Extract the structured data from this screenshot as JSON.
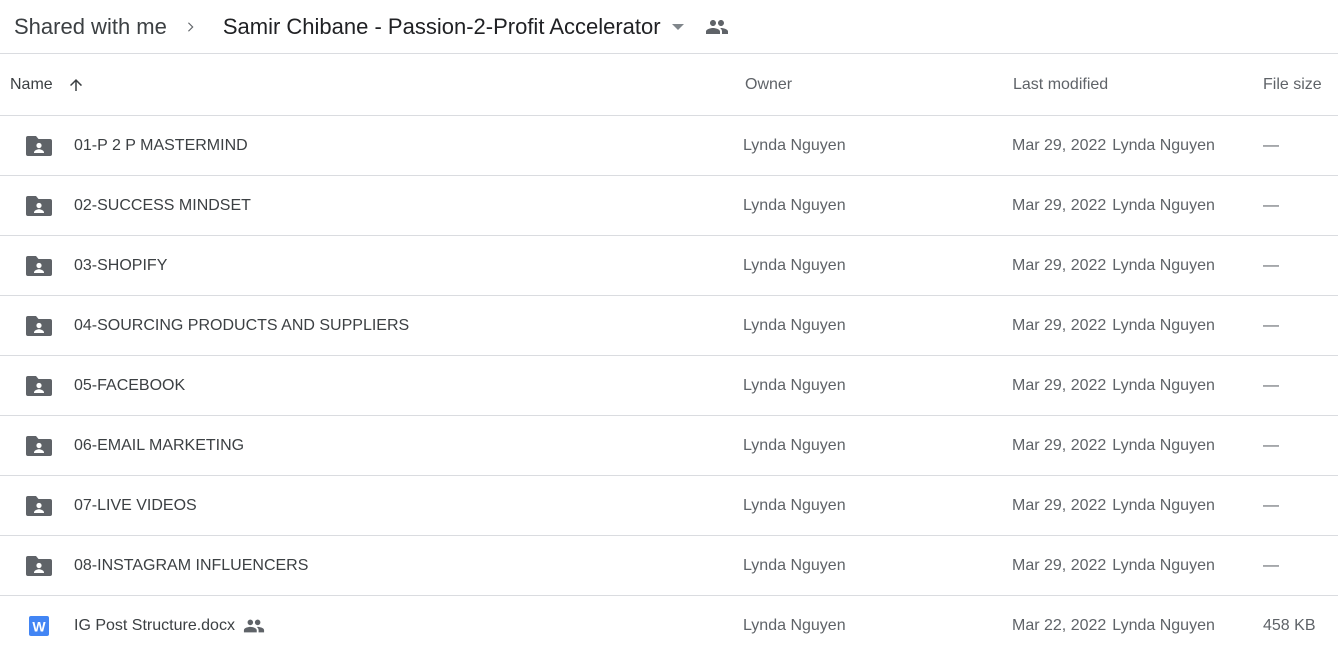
{
  "breadcrumb": {
    "root": "Shared with me",
    "current": "Samir Chibane - Passion-2-Profit Accelerator"
  },
  "columns": {
    "name": "Name",
    "owner": "Owner",
    "last_modified": "Last modified",
    "file_size": "File size"
  },
  "rows": [
    {
      "type": "folder",
      "name": "01-P 2 P MASTERMIND",
      "owner": "Lynda Nguyen",
      "modified_date": "Mar 29, 2022",
      "modified_by": "Lynda Nguyen",
      "size": "—"
    },
    {
      "type": "folder",
      "name": "02-SUCCESS MINDSET",
      "owner": "Lynda Nguyen",
      "modified_date": "Mar 29, 2022",
      "modified_by": "Lynda Nguyen",
      "size": "—"
    },
    {
      "type": "folder",
      "name": "03-SHOPIFY",
      "owner": "Lynda Nguyen",
      "modified_date": "Mar 29, 2022",
      "modified_by": "Lynda Nguyen",
      "size": "—"
    },
    {
      "type": "folder",
      "name": "04-SOURCING PRODUCTS AND SUPPLIERS",
      "owner": "Lynda Nguyen",
      "modified_date": "Mar 29, 2022",
      "modified_by": "Lynda Nguyen",
      "size": "—"
    },
    {
      "type": "folder",
      "name": "05-FACEBOOK",
      "owner": "Lynda Nguyen",
      "modified_date": "Mar 29, 2022",
      "modified_by": "Lynda Nguyen",
      "size": "—"
    },
    {
      "type": "folder",
      "name": "06-EMAIL MARKETING",
      "owner": "Lynda Nguyen",
      "modified_date": "Mar 29, 2022",
      "modified_by": "Lynda Nguyen",
      "size": "—"
    },
    {
      "type": "folder",
      "name": "07-LIVE VIDEOS",
      "owner": "Lynda Nguyen",
      "modified_date": "Mar 29, 2022",
      "modified_by": "Lynda Nguyen",
      "size": "—"
    },
    {
      "type": "folder",
      "name": "08-INSTAGRAM INFLUENCERS",
      "owner": "Lynda Nguyen",
      "modified_date": "Mar 29, 2022",
      "modified_by": "Lynda Nguyen",
      "size": "—"
    },
    {
      "type": "word-doc",
      "name": "IG Post Structure.docx",
      "owner": "Lynda Nguyen",
      "modified_date": "Mar 22, 2022",
      "modified_by": "Lynda Nguyen",
      "size": "458 KB",
      "shared": true,
      "icon_letter": "W"
    }
  ],
  "colors": {
    "folder_icon": "#5f6368",
    "word_icon": "#4285f4",
    "border": "#dadce0",
    "secondary_text": "#5f6368"
  },
  "icons": {
    "breadcrumb_separator": "chevron-right-icon",
    "breadcrumb_caret": "caret-down-icon",
    "shared": "people-icon",
    "sort": "arrow-up-icon",
    "folder": "shared-folder-icon",
    "word": "word-doc-icon"
  }
}
